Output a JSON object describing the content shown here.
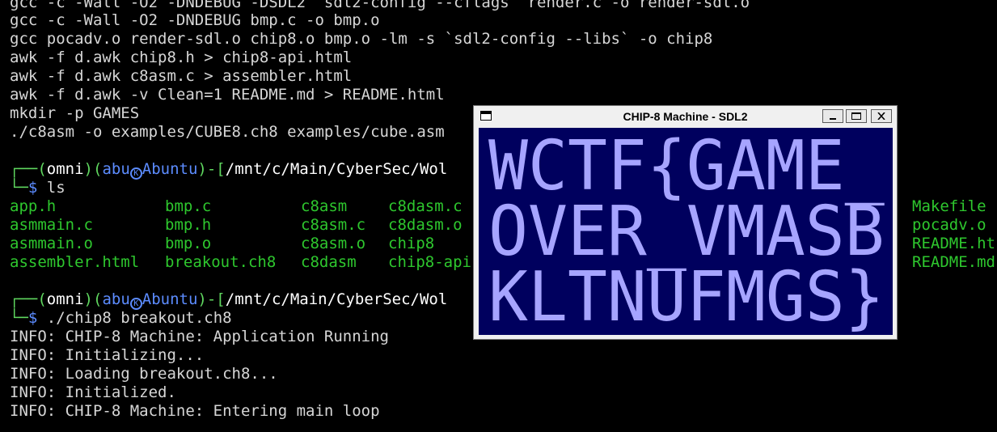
{
  "terminal": {
    "build_lines": [
      "gcc -c -Wall -O2 -DNDEBUG -DSDL2 `sdl2-config --cflags` render.c -o render-sdl.o",
      "gcc -c -Wall -O2 -DNDEBUG bmp.c -o bmp.o",
      "gcc pocadv.o render-sdl.o chip8.o bmp.o -lm -s `sdl2-config --libs` -o chip8",
      "awk -f d.awk chip8.h > chip8-api.html",
      "awk -f d.awk c8asm.c > assembler.html",
      "awk -f d.awk -v Clean=1 README.md > README.html",
      "mkdir -p GAMES",
      "./c8asm -o examples/CUBE8.ch8 examples/cube.asm"
    ],
    "prompt1": {
      "corner": "┌──",
      "open_paren": "(",
      "env": "omni",
      "close_paren": ")",
      "user": "abu",
      "host": "Abuntu",
      "dash_bracket": ")-[",
      "path": "/mnt/c/Main/CyberSec/Wol",
      "arrow": "└─",
      "dollar": "$",
      "command": "ls"
    },
    "ls_rows": [
      [
        "app.h",
        "bmp.c",
        "c8asm",
        "c8dasm.c",
        "Makefile"
      ],
      [
        "asmmain.c",
        "bmp.h",
        "c8asm.c",
        "c8dasm.o",
        "pocadv.o"
      ],
      [
        "asmmain.o",
        "bmp.o",
        "c8asm.o",
        "chip8",
        "README.ht"
      ],
      [
        "assembler.html",
        "breakout.ch8",
        "c8dasm",
        "chip8-api",
        "README.md"
      ]
    ],
    "prompt2": {
      "corner": "┌──",
      "open_paren": "(",
      "env": "omni",
      "close_paren": ")",
      "user": "abu",
      "host": "Abuntu",
      "dash_bracket": ")-[",
      "path": "/mnt/c/Main/CyberSec/Wol",
      "arrow": "└─",
      "dollar": "$",
      "command": "./chip8 breakout.ch8"
    },
    "output_lines": [
      "INFO: CHIP-8 Machine: Application Running",
      "INFO: Initializing...",
      "INFO: Loading breakout.ch8...",
      "INFO: Initialized.",
      "INFO: CHIP-8 Machine: Entering main loop"
    ]
  },
  "sdl_window": {
    "title": "CHIP-8 Machine - SDL2",
    "screen_lines": [
      "WCTF{GAME_",
      "OVER_VMASB",
      "KLTNUFMGS}"
    ],
    "colors": {
      "background": "#00005e",
      "foreground": "#a6a4ff"
    }
  }
}
